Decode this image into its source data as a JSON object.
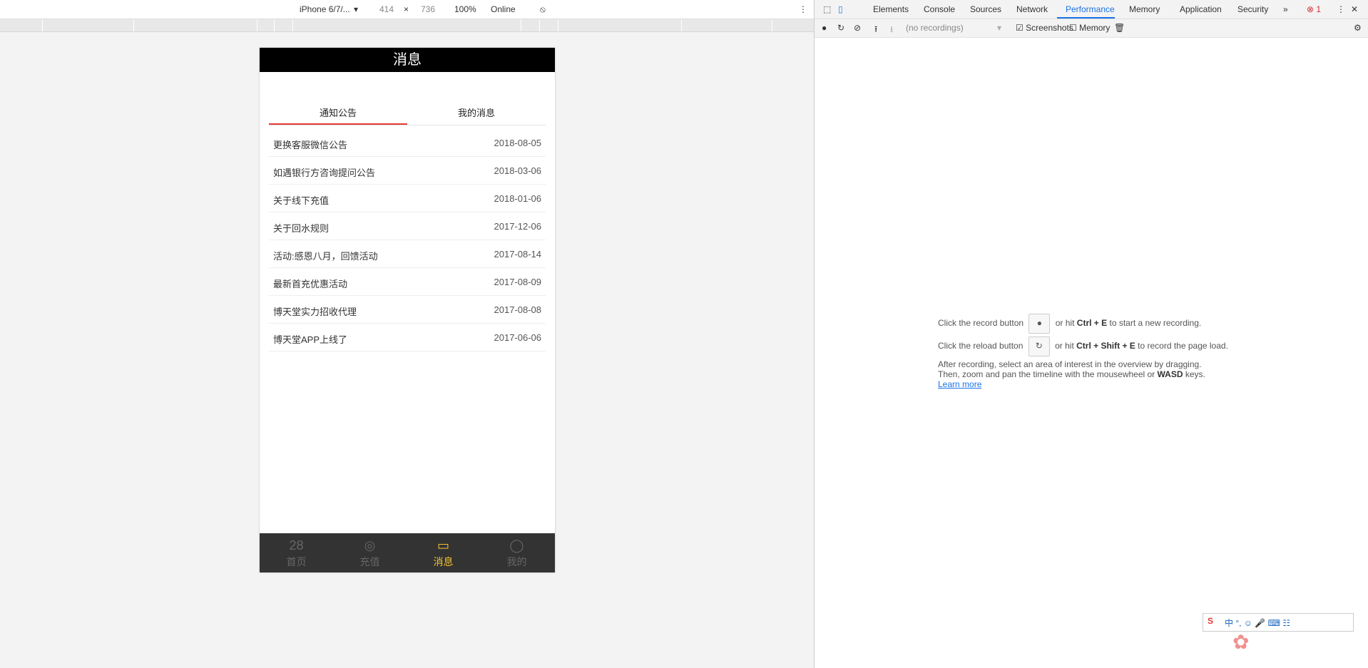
{
  "devtools_toolbar": {
    "device": "iPhone 6/7/...",
    "width": "414",
    "x": "×",
    "height": "736",
    "zoom": "100%",
    "throttle": "Online"
  },
  "phone": {
    "header_title": "消息",
    "tabs": [
      {
        "label": "通知公告",
        "active": true
      },
      {
        "label": "我的消息",
        "active": false
      }
    ],
    "items": [
      {
        "title": "更换客服微信公告",
        "date": "2018-08-05"
      },
      {
        "title": "如遇银行方咨询提问公告",
        "date": "2018-03-06"
      },
      {
        "title": "关于线下充值",
        "date": "2018-01-06"
      },
      {
        "title": "关于回水规则",
        "date": "2017-12-06"
      },
      {
        "title": "活动:感恩八月，回馈活动",
        "date": "2017-08-14"
      },
      {
        "title": "最新首充优惠活动",
        "date": "2017-08-09"
      },
      {
        "title": "博天堂实力招收代理",
        "date": "2017-08-08"
      },
      {
        "title": "博天堂APP上线了",
        "date": "2017-06-06"
      }
    ],
    "bottom_nav": [
      {
        "label": "首页",
        "icon": "home-icon"
      },
      {
        "label": "充值",
        "icon": "recharge-icon"
      },
      {
        "label": "消息",
        "icon": "message-icon",
        "active": true
      },
      {
        "label": "我的",
        "icon": "user-icon"
      }
    ]
  },
  "devtools_panel": {
    "tabs": [
      "Elements",
      "Console",
      "Sources",
      "Network",
      "Performance",
      "Memory",
      "Application",
      "Security"
    ],
    "active_tab": "Performance",
    "error_count": "1",
    "recordings_placeholder": "(no recordings)",
    "screenshots_label": "Screenshots",
    "memory_label": "Memory",
    "instructions": {
      "line1_a": "Click the record button",
      "line1_b": "or hit",
      "line1_keys": "Ctrl + E",
      "line1_c": "to start a new recording.",
      "line2_a": "Click the reload button",
      "line2_b": "or hit",
      "line2_keys": "Ctrl + Shift + E",
      "line2_c": "to record the page load.",
      "line3": "After recording, select an area of interest in the overview by dragging.",
      "line4_a": "Then, zoom and pan the timeline with the mousewheel or",
      "line4_keys": "WASD",
      "line4_b": "keys.",
      "learn_more": "Learn more"
    }
  }
}
